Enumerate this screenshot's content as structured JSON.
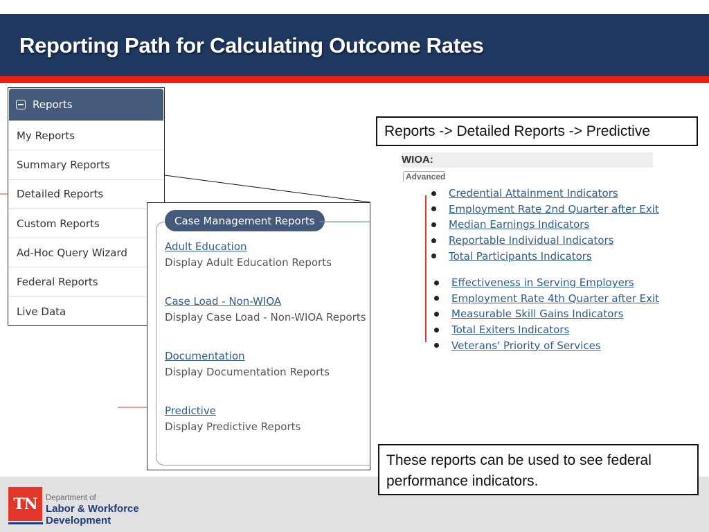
{
  "slide": {
    "title": "Reporting Path for Calculating Outcome Rates",
    "colors": {
      "title_bar": "#1f3860",
      "accent_stripe": "#f01c0d",
      "menu_header": "#445a7a",
      "link": "#2e5d8e",
      "annotation_arrow": "#e0392e"
    }
  },
  "reports_menu": {
    "header_icon": "collapse-minus-icon",
    "header_label": "Reports",
    "items": [
      {
        "label": "My Reports"
      },
      {
        "label": "Summary Reports"
      },
      {
        "label": "Detailed Reports",
        "annotated": true
      },
      {
        "label": "Custom Reports"
      },
      {
        "label": "Ad-Hoc Query Wizard"
      },
      {
        "label": "Federal Reports"
      },
      {
        "label": "Live Data"
      }
    ]
  },
  "case_management": {
    "title": "Case Management Reports",
    "entries": [
      {
        "link": "Adult Education",
        "description": "Display Adult Education Reports"
      },
      {
        "link": "Case Load - Non-WIOA",
        "description": "Display Case Load - Non-WIOA Reports"
      },
      {
        "link": "Documentation",
        "description": "Display Documentation Reports"
      },
      {
        "link": "Predictive",
        "description": "Display Predictive Reports",
        "annotated": true
      }
    ]
  },
  "path_callout": "Reports -> Detailed Reports -> Predictive",
  "wioa": {
    "label": "WIOA:",
    "advanced_tag": "Advanced",
    "group1": [
      "Credential Attainment Indicators",
      "Employment Rate 2nd Quarter after Exit",
      "Median Earnings Indicators",
      "Reportable Individual Indicators",
      "Total Participants Indicators"
    ],
    "group2": [
      "Effectiveness in Serving Employers",
      "Employment Rate 4th Quarter after Exit",
      "Measurable Skill Gains Indicators",
      "Total Exiters Indicators",
      "Veterans' Priority of Services"
    ]
  },
  "note_callout": "These reports can be used to see federal performance indicators.",
  "footer": {
    "logo_mark": "TN",
    "dept_line1": "Department of",
    "dept_line2": "Labor & Workforce",
    "dept_line3": "Development"
  }
}
